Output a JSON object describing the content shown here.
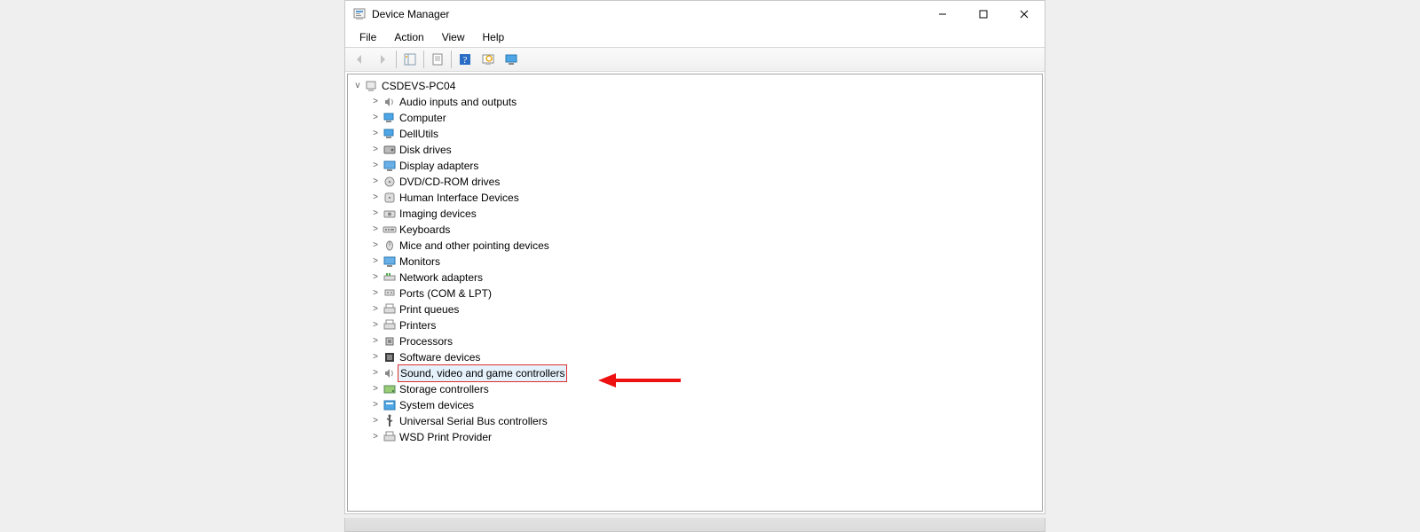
{
  "window": {
    "title": "Device Manager"
  },
  "menu": {
    "file": "File",
    "action": "Action",
    "view": "View",
    "help": "Help"
  },
  "toolbar": {
    "back": "Back",
    "forward": "Forward",
    "show_hide": "Show/Hide Console Tree",
    "properties": "Properties",
    "help": "Help",
    "scan": "Scan for hardware changes",
    "monitor": "Add legacy hardware"
  },
  "tree": {
    "root": "CSDEVS-PC04",
    "categories": [
      {
        "label": "Audio inputs and outputs",
        "icon": "speaker-icon"
      },
      {
        "label": "Computer",
        "icon": "computer-icon"
      },
      {
        "label": "DellUtils",
        "icon": "dell-icon"
      },
      {
        "label": "Disk drives",
        "icon": "disk-icon"
      },
      {
        "label": "Display adapters",
        "icon": "display-icon"
      },
      {
        "label": "DVD/CD-ROM drives",
        "icon": "cdrom-icon"
      },
      {
        "label": "Human Interface Devices",
        "icon": "hid-icon"
      },
      {
        "label": "Imaging devices",
        "icon": "imaging-icon"
      },
      {
        "label": "Keyboards",
        "icon": "keyboard-icon"
      },
      {
        "label": "Mice and other pointing devices",
        "icon": "mouse-icon"
      },
      {
        "label": "Monitors",
        "icon": "monitor-icon"
      },
      {
        "label": "Network adapters",
        "icon": "network-icon"
      },
      {
        "label": "Ports (COM & LPT)",
        "icon": "ports-icon"
      },
      {
        "label": "Print queues",
        "icon": "print-queue-icon"
      },
      {
        "label": "Printers",
        "icon": "printer-icon"
      },
      {
        "label": "Processors",
        "icon": "processor-icon"
      },
      {
        "label": "Software devices",
        "icon": "software-icon"
      },
      {
        "label": "Sound, video and game controllers",
        "icon": "sound-icon",
        "highlight": true
      },
      {
        "label": "Storage controllers",
        "icon": "storage-icon"
      },
      {
        "label": "System devices",
        "icon": "system-icon"
      },
      {
        "label": "Universal Serial Bus controllers",
        "icon": "usb-icon"
      },
      {
        "label": "WSD Print Provider",
        "icon": "wsd-icon"
      }
    ]
  },
  "annotation": {
    "arrow_color": "#e11"
  }
}
